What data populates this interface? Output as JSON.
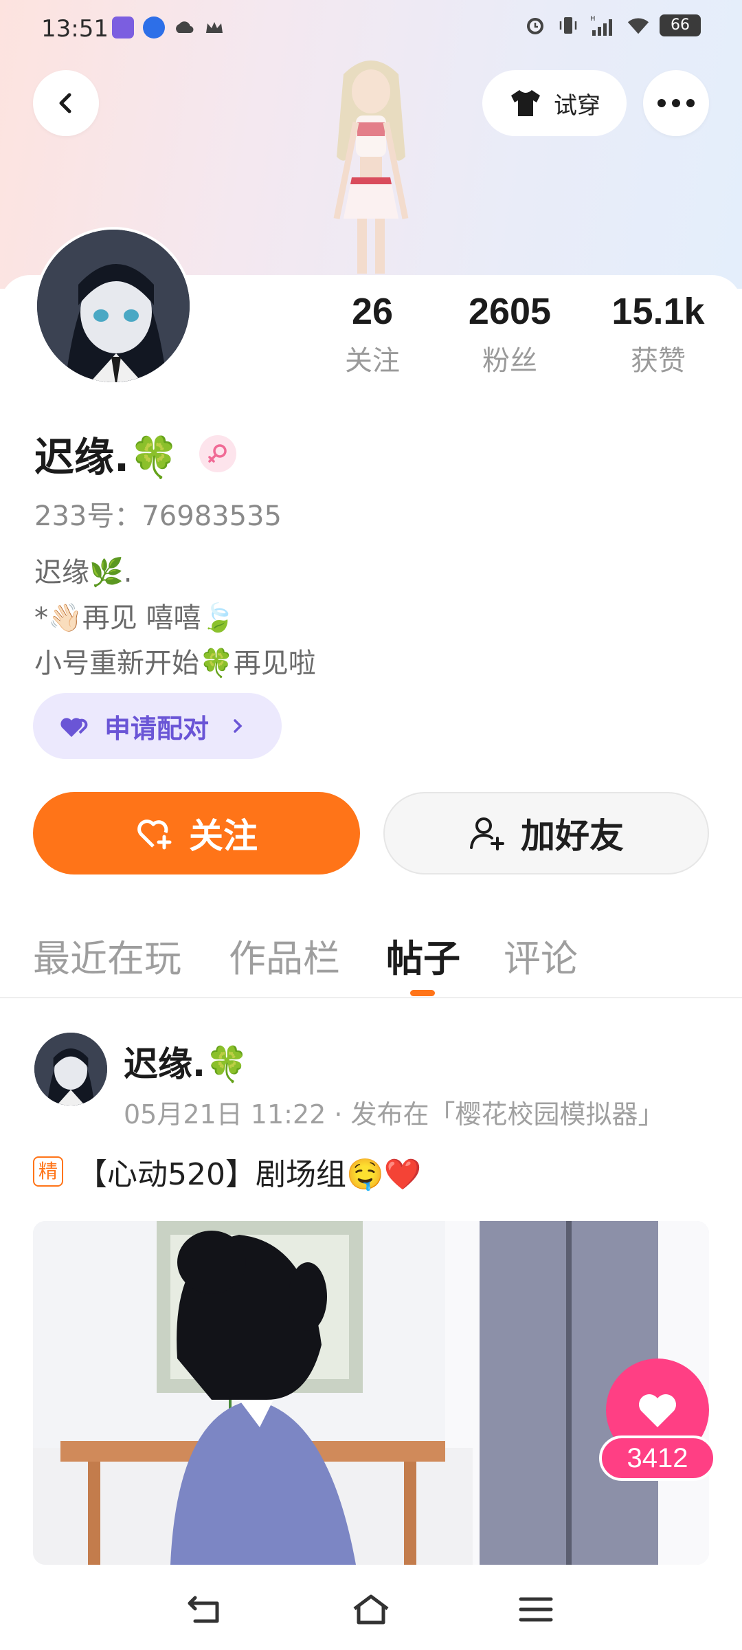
{
  "status_bar": {
    "time": "13:51",
    "battery": "66",
    "icons": [
      "app-fanqie-icon",
      "app-baidu-icon",
      "cloud-icon",
      "crown-icon",
      "alarm-icon",
      "vibrate-icon",
      "signal-icon",
      "wifi-icon",
      "battery-icon"
    ]
  },
  "header": {
    "back_icon": "chevron-left-icon",
    "tryon_label": "试穿",
    "more_icon": "more-dots-icon"
  },
  "profile": {
    "stats": [
      {
        "value": "26",
        "label": "关注"
      },
      {
        "value": "2605",
        "label": "粉丝"
      },
      {
        "value": "15.1k",
        "label": "获赞"
      }
    ],
    "name": "迟缘.🍀",
    "gender": "female",
    "uid_line": "233号：76983535",
    "bio_lines": [
      "迟缘🌿.",
      "*👋🏻再见 嘻嘻🍃",
      "小号重新开始🍀再见啦"
    ],
    "pair_button": "申请配对",
    "follow_button": "关注",
    "add_friend_button": "加好友"
  },
  "tabs": [
    {
      "label": "最近在玩",
      "active": false
    },
    {
      "label": "作品栏",
      "active": false
    },
    {
      "label": "帖子",
      "active": true
    },
    {
      "label": "评论",
      "active": false
    }
  ],
  "post": {
    "author": "迟缘.🍀",
    "meta": "05月21日 11:22 · 发布在「樱花校园模拟器」",
    "badge": "精",
    "title": "【心动520】剧场组🤤❤️",
    "like_count": "3412"
  },
  "colors": {
    "accent": "#ff7418",
    "pair": "#6a55d6",
    "like": "#ff3f84"
  },
  "nav": [
    "back-nav-icon",
    "home-nav-icon",
    "menu-nav-icon"
  ]
}
